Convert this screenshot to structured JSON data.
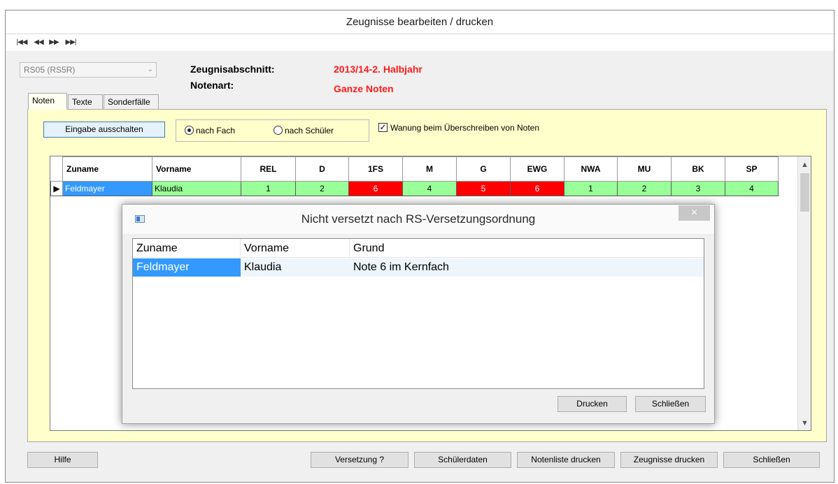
{
  "window": {
    "title": "Zeugnisse bearbeiten / drucken"
  },
  "nav": {
    "first": "|◀◀",
    "prev": "◀◀",
    "next": "▶▶",
    "last": "▶▶|"
  },
  "class_select": {
    "value": "RS05  (RS5R)"
  },
  "info": {
    "section_label": "Zeugnisabschnitt:",
    "section_value": "2013/14-2. Halbjahr",
    "grade_type_label": "Notenart:",
    "grade_type_value": "Ganze Noten"
  },
  "tabs": [
    {
      "label": "Noten",
      "active": true
    },
    {
      "label": "Texte",
      "active": false
    },
    {
      "label": "Sonderfälle",
      "active": false
    }
  ],
  "toolbar": {
    "input_toggle_label": "Eingabe ausschalten",
    "radio_subject_label": "nach Fach",
    "radio_student_label": "nach Schüler",
    "radio_selected": "nach Fach",
    "warn_checkbox_label": "Wanung beim Überschreiben von Noten",
    "warn_checked": true
  },
  "grades_table": {
    "columns": [
      "Zuname",
      "Vorname",
      "REL",
      "D",
      "1FS",
      "M",
      "G",
      "EWG",
      "NWA",
      "MU",
      "BK",
      "SP"
    ],
    "rows": [
      {
        "row_indicator": "▶",
        "cells": [
          "Feldmayer",
          "Klaudia",
          "1",
          "2",
          "6",
          "4",
          "5",
          "6",
          "1",
          "2",
          "3",
          "4"
        ],
        "status": [
          "selected",
          "green",
          "green",
          "green",
          "red",
          "green",
          "red",
          "red",
          "green",
          "green",
          "green",
          "green"
        ]
      }
    ]
  },
  "status_colors": {
    "green": "#99ff99",
    "red": "#ff0000",
    "selected": "#3399ff"
  },
  "dialog": {
    "title": "Nicht versetzt nach RS-Versetzungsordnung",
    "close_icon": "×",
    "columns": [
      "Zuname",
      "Vorname",
      "Grund"
    ],
    "rows": [
      {
        "cells": [
          "Feldmayer",
          "Klaudia",
          "Note 6 im Kernfach"
        ]
      }
    ],
    "print_label": "Drucken",
    "close_label": "Schließen"
  },
  "footer": {
    "help": "Hilfe",
    "promotion": "Versetzung ?",
    "student_data": "Schülerdaten",
    "print_gradelist": "Notenliste drucken",
    "print_reports": "Zeugnisse drucken",
    "close": "Schließen"
  },
  "icons": {
    "scroll_up": "▲",
    "scroll_down": "▼",
    "combo_arrow": "⌄"
  }
}
